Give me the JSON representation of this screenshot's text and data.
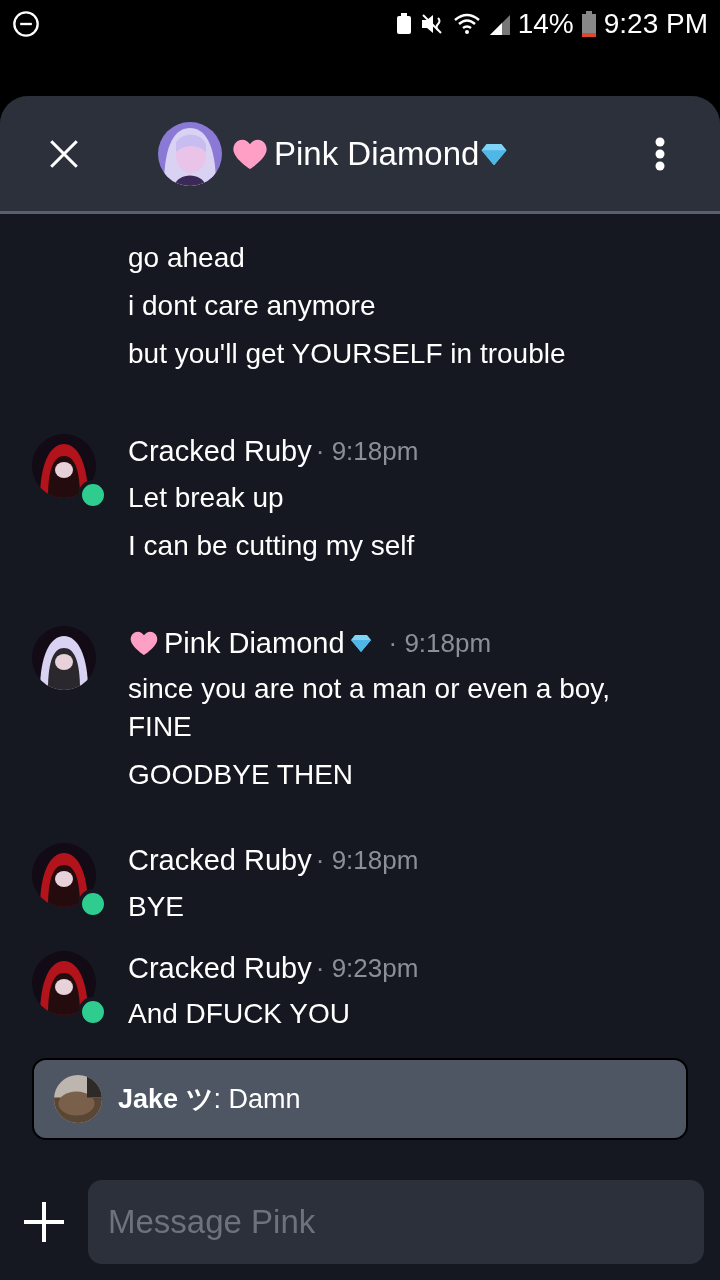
{
  "status_bar": {
    "battery": "14%",
    "time": "9:23 PM"
  },
  "header": {
    "title": "Pink Diamond"
  },
  "messages": [
    {
      "kind": "continuation",
      "lines": [
        "go ahead",
        "i dont care anymore",
        "but you'll get YOURSELF in trouble"
      ]
    },
    {
      "kind": "group",
      "author": "Cracked Ruby",
      "badges": false,
      "time": "· 9:18pm",
      "avatar": {
        "kind": "picture",
        "color": "#b3131b"
      },
      "online": true,
      "lines": [
        "Let break up",
        "I can be cutting my self"
      ]
    },
    {
      "kind": "group",
      "author": "Pink Diamond",
      "badges": true,
      "time": "· 9:18pm",
      "avatar": {
        "kind": "picture",
        "color": "#d9d2f2"
      },
      "online": false,
      "lines": [
        "since you are not a man or even a boy, FINE",
        "GOODBYE THEN"
      ]
    },
    {
      "kind": "group",
      "author": "Cracked Ruby",
      "badges": false,
      "time": "· 9:18pm",
      "avatar": {
        "kind": "picture",
        "color": "#b3131b"
      },
      "online": true,
      "lines": [
        "BYE"
      ]
    },
    {
      "kind": "group",
      "author": "Cracked Ruby",
      "badges": false,
      "time": "· 9:23pm",
      "avatar": {
        "kind": "picture",
        "color": "#b3131b"
      },
      "online": true,
      "lines": [
        "And DFUCK YOU"
      ]
    }
  ],
  "notification": {
    "text": "**Jake ツ**: Damn"
  },
  "composer": {
    "placeholder": "Message Pink"
  }
}
